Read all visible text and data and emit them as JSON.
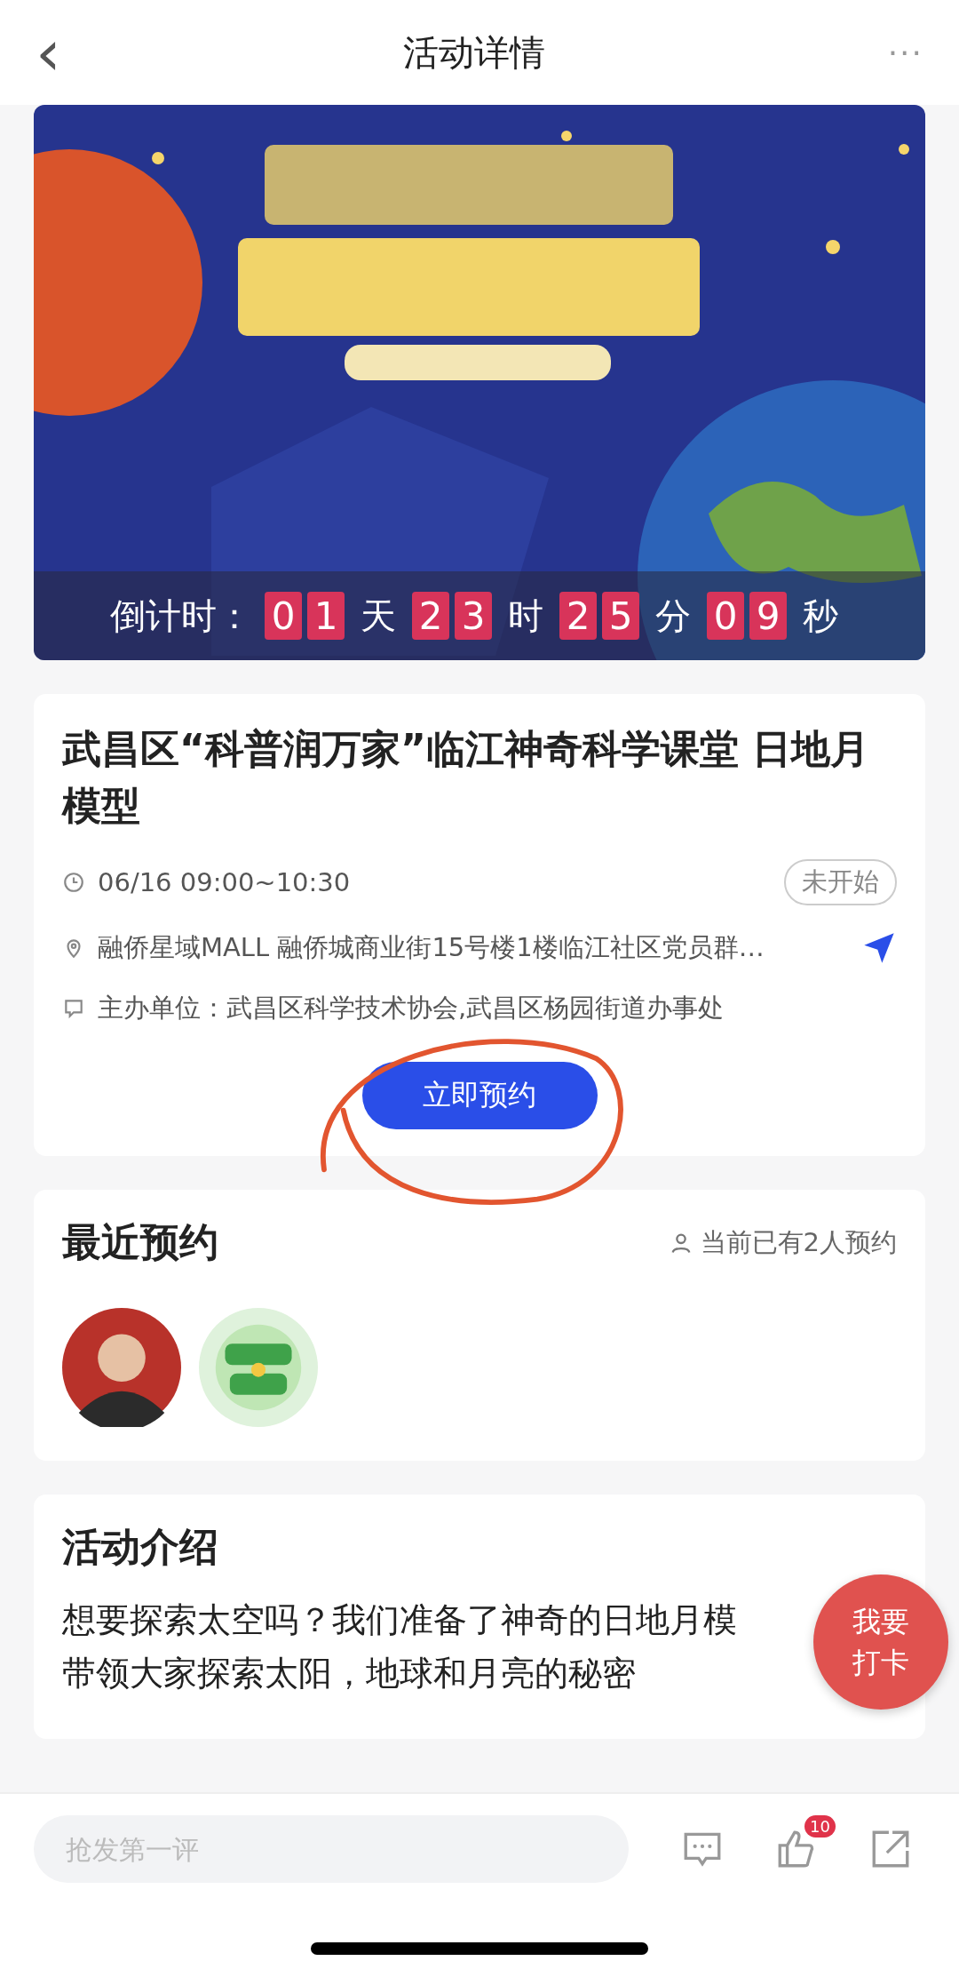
{
  "nav": {
    "back": "‹",
    "title": "活动详情",
    "more": "···"
  },
  "banner": {
    "kind": "picture",
    "countdown": {
      "label": "倒计时：",
      "units": [
        {
          "digits": [
            "0",
            "1"
          ],
          "unit": "天"
        },
        {
          "digits": [
            "2",
            "3"
          ],
          "unit": "时"
        },
        {
          "digits": [
            "2",
            "5"
          ],
          "unit": "分"
        },
        {
          "digits": [
            "0",
            "9"
          ],
          "unit": "秒"
        }
      ]
    }
  },
  "event": {
    "title": "武昌区“科普润万家”临江神奇科学课堂 日地月模型",
    "time": "06/16 09:00~10:30",
    "status": "未开始",
    "location": "融侨星域MALL 融侨城商业街15号楼1楼临江社区党员群…",
    "organizer": "主办单位：武昌区科学技术协会,武昌区杨园街道办事处",
    "button": "立即预约"
  },
  "recent": {
    "title": "最近预约",
    "count": "当前已有2人预约",
    "avatars": [
      {
        "kind": "person"
      },
      {
        "kind": "picture"
      }
    ]
  },
  "intro": {
    "title": "活动介绍",
    "lines": [
      "想要探索太空吗？我们准备了神奇的日地月模",
      "带领大家探索太阳，地球和月亮的秘密"
    ],
    "fab": [
      "我要",
      "打卡"
    ]
  },
  "bottom_bar": {
    "placeholder": "抢发第一评",
    "like_badge": "10"
  }
}
